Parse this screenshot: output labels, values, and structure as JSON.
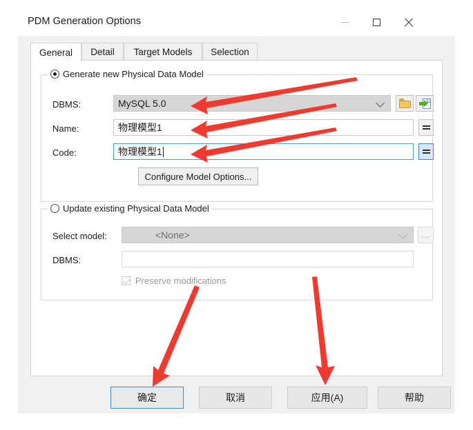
{
  "window": {
    "title": "PDM Generation Options",
    "controls": {
      "minimize": "minimize-icon",
      "maximize": "maximize-icon",
      "close": "close-icon"
    }
  },
  "tabs": [
    {
      "label": "General",
      "selected": true
    },
    {
      "label": "Detail",
      "selected": false
    },
    {
      "label": "Target Models",
      "selected": false
    },
    {
      "label": "Selection",
      "selected": false
    }
  ],
  "generate_group": {
    "legend": "Generate new Physical Data Model",
    "radio_selected": true,
    "dbms": {
      "label": "DBMS:",
      "value": "MySQL 5.0",
      "chevron": "chevron-down-icon",
      "folder_button": "folder-icon",
      "import_button": "import-model-icon"
    },
    "name": {
      "label": "Name:",
      "value": "物理模型1",
      "equals_button": "="
    },
    "code": {
      "label": "Code:",
      "value": "物理模型1",
      "focused": true,
      "equals_button": "="
    },
    "configure_button": "Configure Model Options..."
  },
  "update_group": {
    "legend": "Update existing Physical Data Model",
    "radio_selected": false,
    "select_model": {
      "label": "Select model:",
      "value": "<None>",
      "chevron": "chevron-down-icon",
      "browse_button": "..."
    },
    "dbms": {
      "label": "DBMS:",
      "value": ""
    },
    "preserve": {
      "label": "Preserve modifications",
      "checked": true,
      "disabled": true
    }
  },
  "footer": {
    "ok": "确定",
    "cancel": "取消",
    "apply": "应用(A)",
    "help": "帮助"
  },
  "annotations": {
    "color": "#f03a30",
    "arrows": [
      {
        "name": "arrow-to-dbms",
        "points_to": "DBMS field"
      },
      {
        "name": "arrow-to-name",
        "points_to": "Name field"
      },
      {
        "name": "arrow-to-code",
        "points_to": "Code field"
      },
      {
        "name": "arrow-to-ok-button",
        "points_to": "确定"
      },
      {
        "name": "arrow-to-apply-button",
        "points_to": "应用(A)"
      }
    ]
  }
}
